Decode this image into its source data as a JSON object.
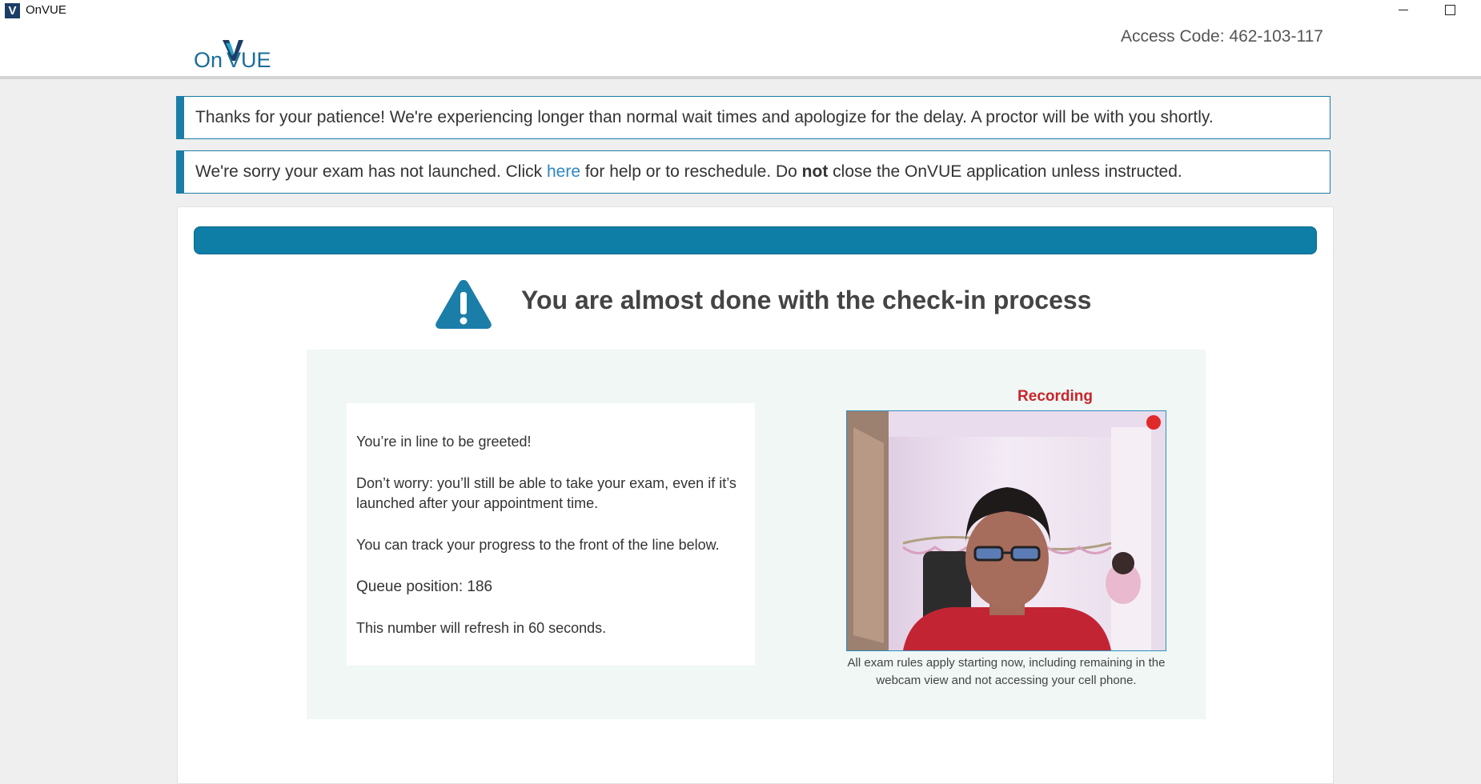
{
  "window": {
    "title": "OnVUE",
    "icon_letter": "V"
  },
  "header": {
    "logo_text_on": "On",
    "logo_text_vue": "VUE",
    "access_code": "Access Code: 462-103-117"
  },
  "alerts": {
    "patience": "Thanks for your patience! We're experiencing longer than normal wait times and apologize for the delay. A proctor will be with you shortly.",
    "launch_prefix": "We're sorry your exam has not launched. Click ",
    "launch_link": "here",
    "launch_middle": " for help or to reschedule. Do ",
    "launch_bold": "not",
    "launch_suffix": " close the OnVUE application unless instructed."
  },
  "main": {
    "heading": "You are almost done with the check-in process",
    "info": {
      "line1": "You’re in line to be greeted!",
      "line2": "Don’t worry: you’ll still be able to take your exam, even if it’s launched after your appointment time.",
      "line3": "You can track your progress to the front of the line below.",
      "queue": "Queue position: 186",
      "refresh": "This number will refresh in 60 seconds."
    },
    "webcam": {
      "recording_label": "Recording",
      "caption": "All exam rules apply starting now, including remaining in the webcam view and not accessing your cell phone."
    }
  },
  "colors": {
    "brand_blue": "#0e7ea7",
    "alert_border": "#1b7ea8",
    "link": "#2d86c4",
    "recording_red": "#c9242b"
  }
}
